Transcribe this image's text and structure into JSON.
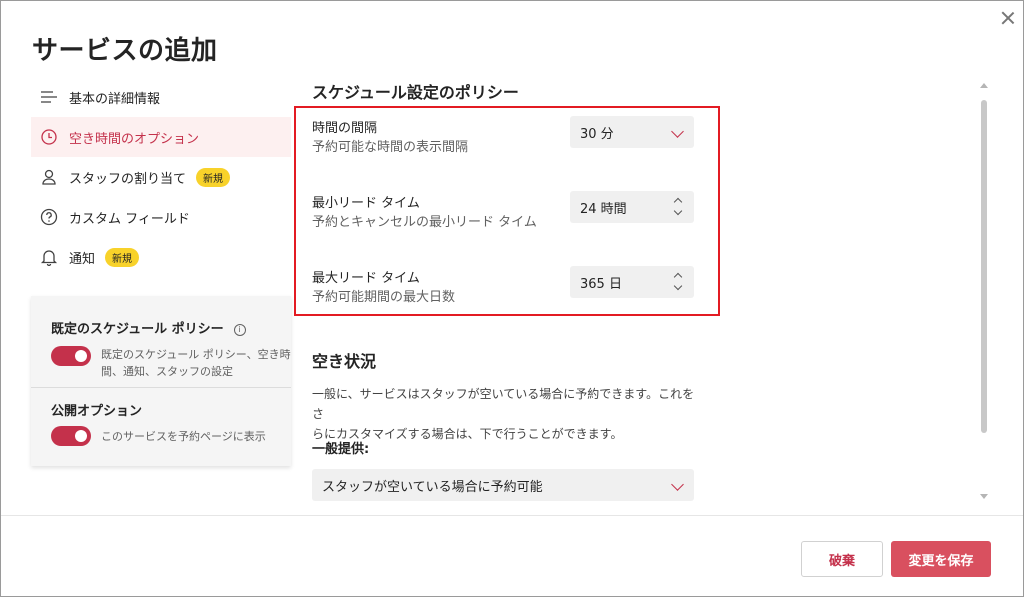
{
  "dialog": {
    "title": "サービスの追加"
  },
  "nav": {
    "items": [
      {
        "label": "基本の詳細情報",
        "icon": "list-icon"
      },
      {
        "label": "空き時間のオプション",
        "icon": "clock-icon"
      },
      {
        "label": "スタッフの割り当て",
        "icon": "person-icon",
        "badge": "新規"
      },
      {
        "label": "カスタム フィールド",
        "icon": "question-icon"
      },
      {
        "label": "通知",
        "icon": "bell-icon",
        "badge": "新規"
      }
    ]
  },
  "settings_card": {
    "default_policy_heading": "既定のスケジュール ポリシー",
    "default_policy_desc_line1": "既定のスケジュール ポリシー、空き時",
    "default_policy_desc_line2": "間、通知、スタッフの設定",
    "default_policy_enabled": true,
    "public_heading": "公開オプション",
    "public_desc": "このサービスを予約ページに表示",
    "public_enabled": true
  },
  "schedule_policy": {
    "heading": "スケジュール設定のポリシー",
    "interval_label": "時間の間隔",
    "interval_desc": "予約可能な時間の表示間隔",
    "interval_value": "30 分",
    "min_lead_label": "最小リード タイム",
    "min_lead_desc": "予約とキャンセルの最小リード タイム",
    "min_lead_value": "24 時間",
    "max_lead_label": "最大リード タイム",
    "max_lead_desc": "予約可能期間の最大日数",
    "max_lead_value": "365 日"
  },
  "availability": {
    "heading": "空き状況",
    "description_line1": "一般に、サービスはスタッフが空いている場合に予約できます。これをさ",
    "description_line2": "らにカスタマイズする場合は、下で行うことができます。",
    "general_label": "一般提供:",
    "general_value": "スタッフが空いている場合に予約可能"
  },
  "footer": {
    "discard_label": "破棄",
    "save_label": "変更を保存"
  },
  "colors": {
    "accent": "#c4314b",
    "save_button": "#d9505f",
    "badge": "#f8d22a",
    "highlight_border": "#e31b23"
  }
}
